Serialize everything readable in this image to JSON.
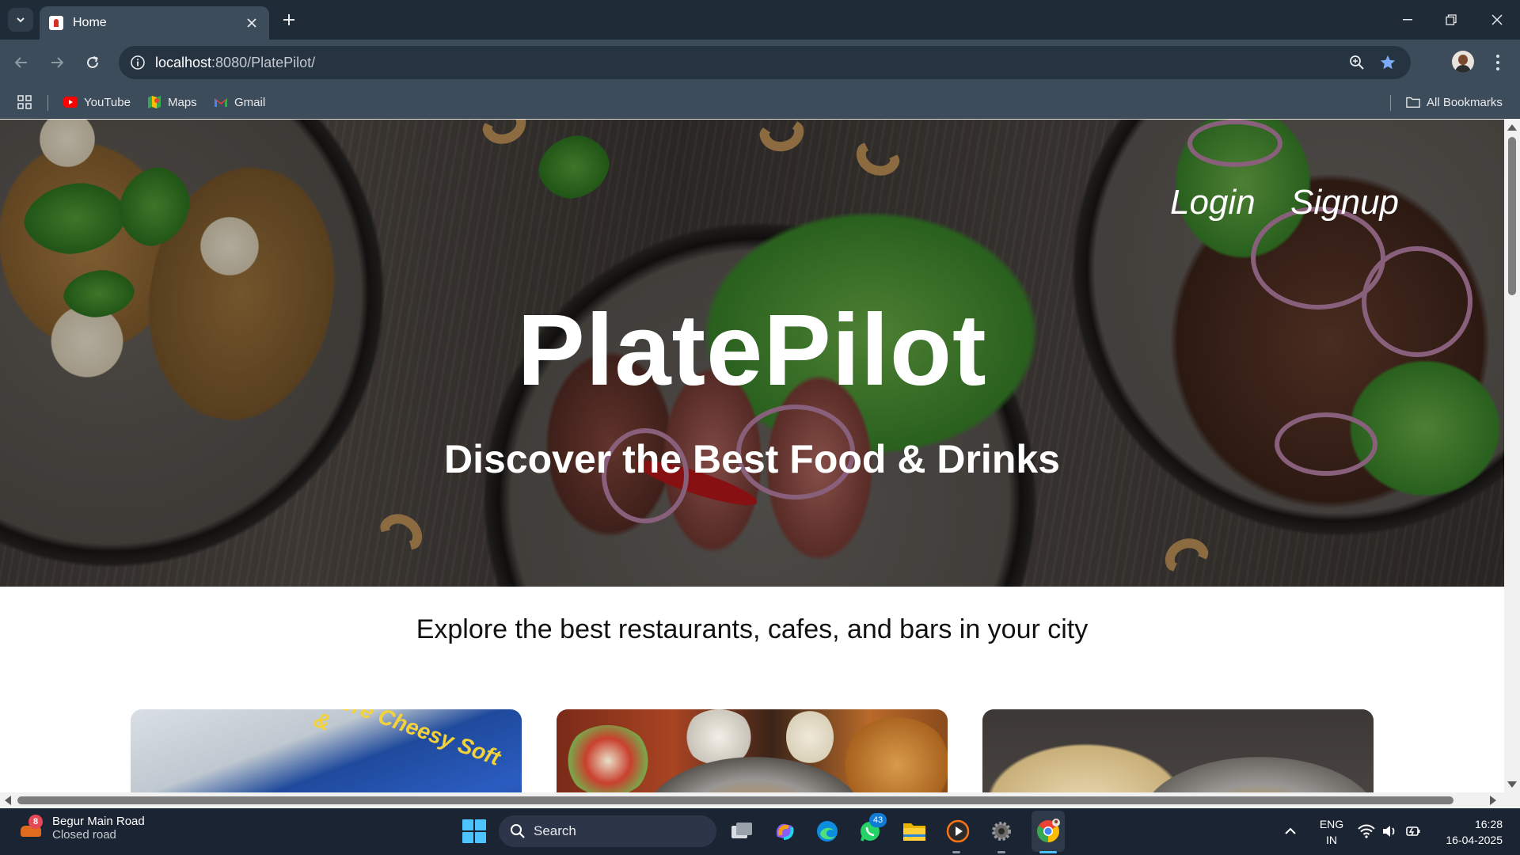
{
  "browser": {
    "tab_title": "Home",
    "url_host": "localhost",
    "url_path": ":8080/PlatePilot/",
    "bookmarks": [
      {
        "label": "YouTube",
        "icon": "youtube-icon"
      },
      {
        "label": "Maps",
        "icon": "maps-icon"
      },
      {
        "label": "Gmail",
        "icon": "gmail-icon"
      }
    ],
    "all_bookmarks_label": "All Bookmarks"
  },
  "page": {
    "nav": {
      "login": "Login",
      "signup": "Signup"
    },
    "brand": "PlatePilot",
    "tagline": "Discover the Best Food & Drinks",
    "explore": "Explore the best restaurants, cafes, and bars in your city",
    "cards": [
      {
        "name": "card-pizza"
      },
      {
        "name": "card-thali"
      },
      {
        "name": "card-roti"
      }
    ],
    "card1_overlay_text": "More Cheesy Soft &"
  },
  "taskbar": {
    "weather_title": "Begur Main Road",
    "weather_sub": "Closed road",
    "weather_badge": "8",
    "search_label": "Search",
    "whatsapp_badge": "43",
    "lang_top": "ENG",
    "lang_bottom": "IN",
    "time": "16:28",
    "date": "16-04-2025"
  },
  "colors": {
    "chrome_dark": "#1f2b36",
    "chrome_toolbar": "#3c4c5a",
    "taskbar": "#1b2433",
    "accent_blue": "#4cc2ff"
  }
}
